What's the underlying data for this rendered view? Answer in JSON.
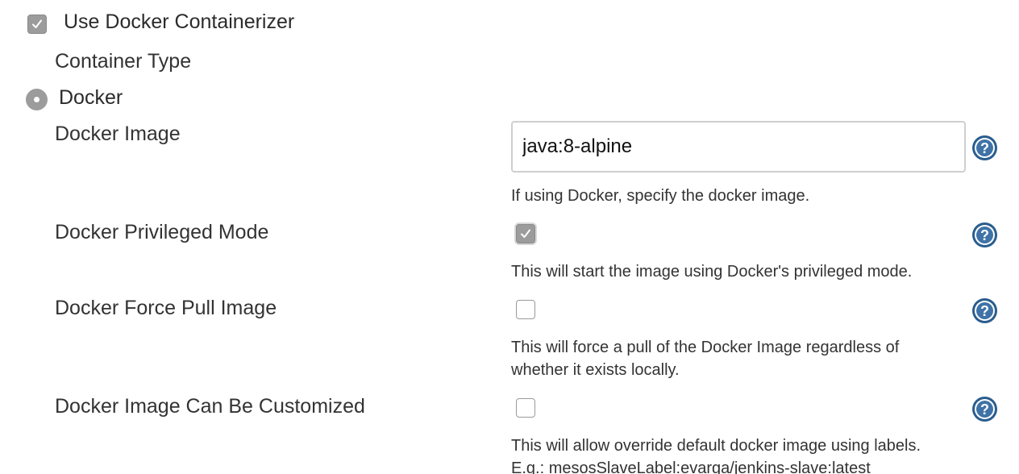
{
  "use_docker": {
    "label": "Use Docker Containerizer",
    "checked": true
  },
  "container_type": {
    "label": "Container Type"
  },
  "docker_radio": {
    "label": "Docker",
    "selected": true
  },
  "docker_image": {
    "label": "Docker Image",
    "value": "java:8-alpine",
    "help": "If using Docker, specify the docker image."
  },
  "privileged_mode": {
    "label": "Docker Privileged Mode",
    "checked": true,
    "help": "This will start the image using Docker's privileged mode."
  },
  "force_pull": {
    "label": "Docker Force Pull Image",
    "checked": false,
    "help_line1": "This will force a pull of the Docker Image regardless of",
    "help_line2": "whether it exists locally."
  },
  "customizable": {
    "label": "Docker Image Can Be Customized",
    "checked": false,
    "help_line1": "This will allow override default docker image using labels.",
    "help_line2": "E.g.: mesosSlaveLabel:evarga/jenkins-slave:latest"
  },
  "help_icon_color": "#2a5d8f"
}
